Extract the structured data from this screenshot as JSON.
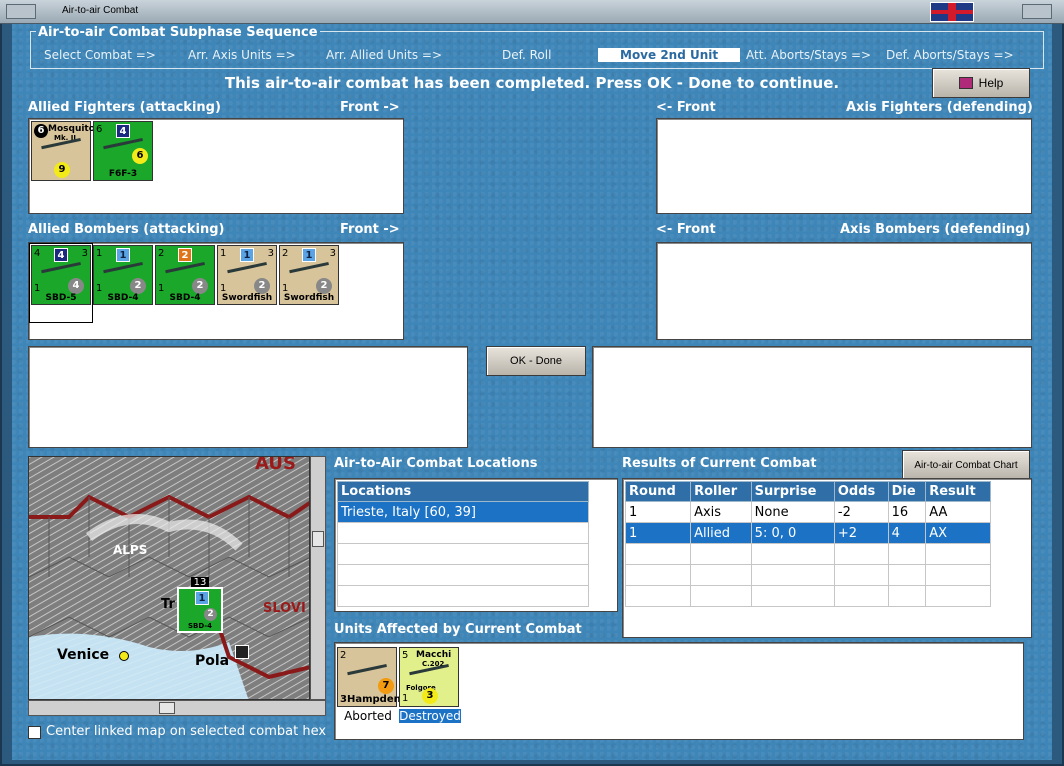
{
  "window": {
    "title": "Air-to-air Combat"
  },
  "sequence": {
    "title": "Air-to-air Combat Subphase Sequence",
    "steps": [
      "Select Combat =>",
      "Arr. Axis Units =>",
      "Arr. Allied Units =>",
      "Def. Roll",
      "Move 2nd Unit",
      "Att. Aborts/Stays =>",
      "Def. Aborts/Stays =>"
    ],
    "active_step": "Move 2nd Unit"
  },
  "message": "This air-to-air combat has been completed.  Press OK - Done to continue.",
  "help_label": "Help",
  "ok_label": "OK - Done",
  "allied_fighters": {
    "label": "Allied Fighters (attacking)",
    "front": "Front ->",
    "units": [
      {
        "name": "Mk. II",
        "title": "Mosquito",
        "tl": "6",
        "badge": "",
        "circle": "9",
        "circle_color": "yellow",
        "color": "tan"
      },
      {
        "name": "F6F-3",
        "title": "",
        "tl": "6",
        "badge": "4",
        "circle": "6",
        "circle_color": "yellow",
        "color": "green"
      }
    ]
  },
  "axis_fighters": {
    "label": "Axis Fighters (defending)",
    "front": "<- Front"
  },
  "allied_bombers": {
    "label": "Allied Bombers (attacking)",
    "front": "Front ->",
    "units": [
      {
        "name": "SBD-5",
        "tl": "4",
        "tr": "3",
        "bl": "1",
        "badge": "4",
        "badge_style": "dark",
        "circle": "4",
        "color": "green"
      },
      {
        "name": "SBD-4",
        "tl": "1",
        "tr": "",
        "bl": "1",
        "badge": "1",
        "badge_style": "light",
        "circle": "2",
        "color": "green"
      },
      {
        "name": "SBD-4",
        "tl": "2",
        "tr": "",
        "bl": "1",
        "badge": "2",
        "badge_style": "orange",
        "circle": "2",
        "color": "green"
      },
      {
        "name": "Swordfish",
        "tl": "1",
        "tr": "3",
        "bl": "1",
        "badge": "1",
        "badge_style": "light",
        "circle": "2",
        "color": "tan"
      },
      {
        "name": "Swordfish",
        "tl": "2",
        "tr": "3",
        "bl": "1",
        "badge": "1",
        "badge_style": "light",
        "circle": "2",
        "color": "tan"
      }
    ]
  },
  "axis_bombers": {
    "label": "Axis Bombers (defending)",
    "front": "<- Front"
  },
  "locations": {
    "title": "Air-to-Air Combat Locations",
    "header": "Locations",
    "rows": [
      "Trieste, Italy [60, 39]",
      "",
      "",
      "",
      ""
    ]
  },
  "results": {
    "title": "Results of Current Combat",
    "chart_button": "Air-to-air Combat Chart",
    "headers": [
      "Round",
      "Roller",
      "Surprise",
      "Odds",
      "Die",
      "Result"
    ],
    "rows": [
      [
        "1",
        "Axis",
        "None",
        "-2",
        "16",
        "AA"
      ],
      [
        "1",
        "Allied",
        "5: 0, 0",
        "+2",
        "4",
        "AX"
      ],
      [
        "",
        "",
        "",
        "",
        "",
        ""
      ],
      [
        "",
        "",
        "",
        "",
        "",
        ""
      ],
      [
        "",
        "",
        "",
        "",
        "",
        ""
      ]
    ]
  },
  "affected": {
    "title": "Units Affected by Current Combat",
    "units": [
      {
        "name": "Hampden",
        "tl": "2",
        "bl": "3",
        "br": "3",
        "circle": "7",
        "status": "Aborted"
      },
      {
        "name": "Folgore",
        "title": "Macchi",
        "sub": "C.202",
        "tl": "5",
        "bl": "1",
        "circle": "3",
        "status": "Destroyed"
      }
    ]
  },
  "map": {
    "labels": [
      "AUS",
      "ALPS",
      "Tr",
      "SLOVI",
      "Venice",
      "Pola"
    ],
    "counter_stack": "13",
    "counter_name": "SBD-4",
    "counter_badge": "1",
    "counter_circle": "2"
  },
  "center_map_label": "Center linked map on selected combat hex"
}
